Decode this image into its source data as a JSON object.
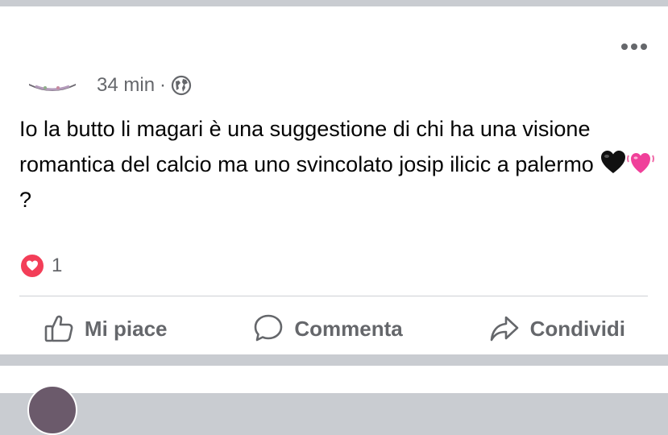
{
  "post": {
    "time": "34 min",
    "separator": "·",
    "privacy_icon": "globe-icon",
    "text_before_emoji": "Io la butto li magari è una suggestione di chi ha una visione romantica del calcio ma uno svincolato josip ilicic a palermo ",
    "text_after_emoji": "?",
    "emojis": [
      "black-heart",
      "beating-heart"
    ],
    "reaction_count": "1",
    "reaction_icon": "love-icon"
  },
  "actions": {
    "like_label": "Mi piace",
    "comment_label": "Commenta",
    "share_label": "Condividi"
  },
  "colors": {
    "text_primary": "#050505",
    "text_secondary": "#65676b",
    "love_red": "#f33e58",
    "divider": "#ced0d4",
    "feed_bg": "#c9ccd1"
  }
}
